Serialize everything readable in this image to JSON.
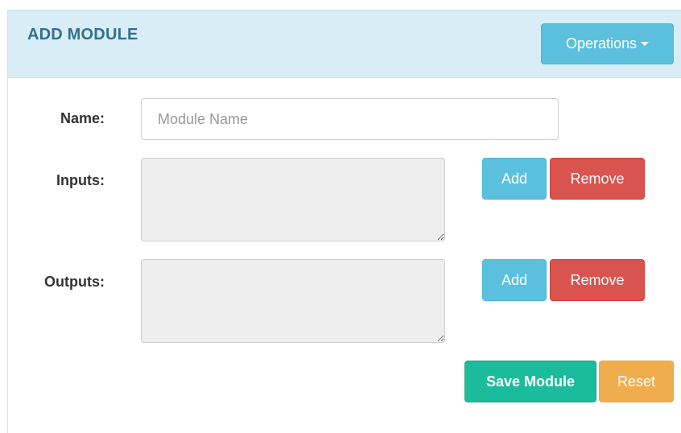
{
  "header": {
    "title": "ADD MODULE",
    "operations_label": "Operations"
  },
  "form": {
    "name_label": "Name:",
    "name_placeholder": "Module Name",
    "name_value": "",
    "inputs_label": "Inputs:",
    "outputs_label": "Outputs:",
    "add_label": "Add",
    "remove_label": "Remove",
    "save_label": "Save Module",
    "reset_label": "Reset"
  },
  "colors": {
    "heading_bg": "#d9edf7",
    "title": "#31708f",
    "info": "#5bc0de",
    "danger": "#d9534f",
    "success": "#1abc9c",
    "warning": "#f0ad4e"
  },
  "icons": {
    "operations_caret": "caret-down-icon"
  }
}
